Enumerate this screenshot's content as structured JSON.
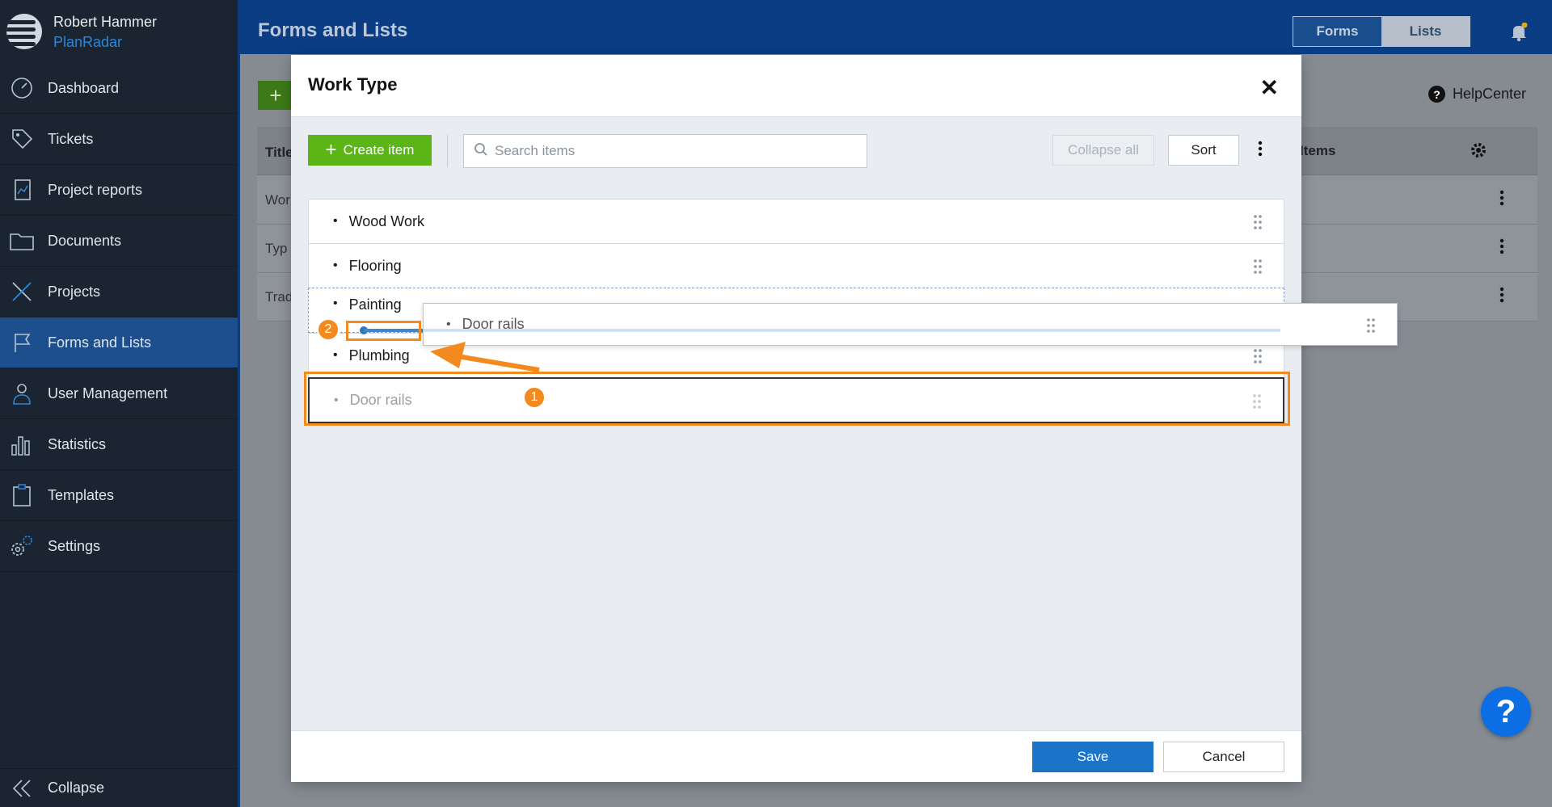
{
  "user": {
    "name": "Robert Hammer",
    "org": "PlanRadar"
  },
  "sidebar": {
    "items": [
      {
        "label": "Dashboard",
        "icon": "gauge-icon"
      },
      {
        "label": "Tickets",
        "icon": "tag-icon"
      },
      {
        "label": "Project reports",
        "icon": "report-icon"
      },
      {
        "label": "Documents",
        "icon": "folder-icon"
      },
      {
        "label": "Projects",
        "icon": "tools-icon"
      },
      {
        "label": "Forms and Lists",
        "icon": "flag-icon",
        "active": true
      },
      {
        "label": "User Management",
        "icon": "user-icon"
      },
      {
        "label": "Statistics",
        "icon": "bar-chart-icon"
      },
      {
        "label": "Templates",
        "icon": "clipboard-icon"
      },
      {
        "label": "Settings",
        "icon": "gears-icon"
      }
    ],
    "collapse_label": "Collapse"
  },
  "topbar": {
    "title": "Forms and Lists",
    "toggle": {
      "forms": "Forms",
      "lists": "Lists"
    }
  },
  "page": {
    "helpcenter": "HelpCenter",
    "table": {
      "col_title": "Title",
      "col_items": "Items",
      "rows": [
        "Wor",
        "Typ",
        "Trad"
      ]
    }
  },
  "modal": {
    "title": "Work Type",
    "create_label": "Create item",
    "search_placeholder": "Search items",
    "collapse_all": "Collapse all",
    "sort": "Sort",
    "items": [
      "Wood Work",
      "Flooring",
      "Painting",
      "Plumbing",
      "Door rails"
    ],
    "dragging_item": "Door rails",
    "save": "Save",
    "cancel": "Cancel"
  },
  "annotations": {
    "step1": "1",
    "step2": "2"
  },
  "colors": {
    "sidebar_bg": "#1b2531",
    "topbar_bg": "#0a3d84",
    "create_green": "#5bb516",
    "save_blue": "#1c74c9",
    "annotation_orange": "#f28a1f"
  }
}
